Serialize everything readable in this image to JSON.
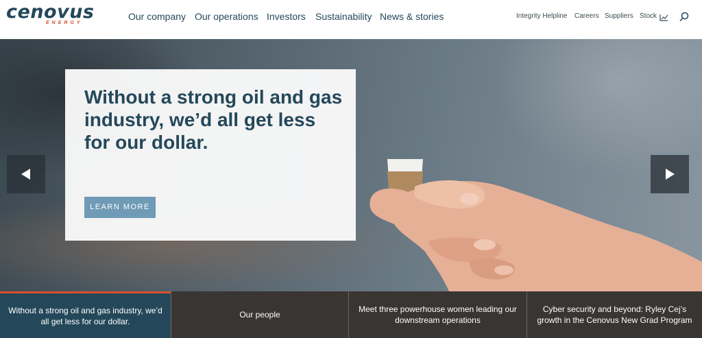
{
  "brand": {
    "name": "cenovus",
    "sub": "ENERGY",
    "primary_color": "#24485a",
    "accent_color": "#d9502d"
  },
  "main_nav": [
    {
      "label": "Our company"
    },
    {
      "label": "Our operations"
    },
    {
      "label": "Investors"
    },
    {
      "label": "Sustainability"
    },
    {
      "label": "News & stories"
    }
  ],
  "utility_nav": [
    {
      "label": "Integrity Helpline"
    },
    {
      "label": "Careers"
    },
    {
      "label": "Suppliers"
    },
    {
      "label": "Stock",
      "icon": "chart-line-icon"
    }
  ],
  "search": {
    "icon": "search-icon"
  },
  "hero": {
    "headline": "Without a strong oil and gas industry, we’d all get less for our dollar.",
    "cta_label": "LEARN MORE",
    "cta_color": "#6f9bb6",
    "prev_icon": "arrow-left-icon",
    "next_icon": "arrow-right-icon"
  },
  "slides": [
    {
      "label": "Without a strong oil and gas industry, we’d all get less for our dollar.",
      "active": true
    },
    {
      "label": "Our people",
      "active": false
    },
    {
      "label": "Meet three powerhouse women leading our downstream operations",
      "active": false
    },
    {
      "label": "Cyber security and beyond: Ryley Cej’s growth in the Cenovus New Grad Program",
      "active": false
    }
  ]
}
